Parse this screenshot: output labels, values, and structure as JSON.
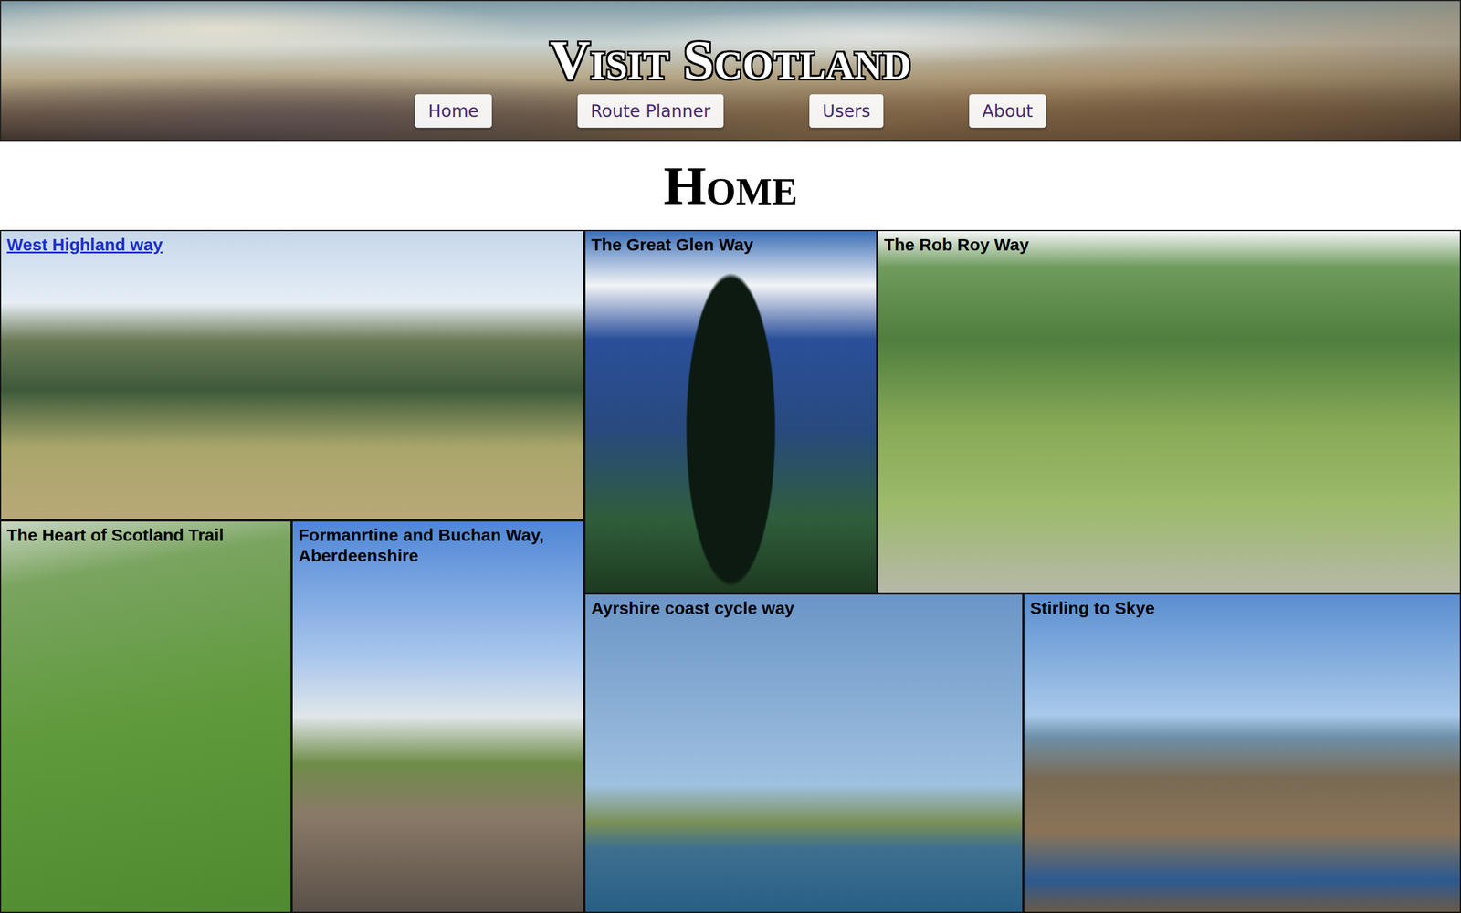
{
  "header": {
    "title": "Visit Scotland"
  },
  "nav": [
    {
      "label": "Home"
    },
    {
      "label": "Route Planner"
    },
    {
      "label": "Users"
    },
    {
      "label": "About"
    }
  ],
  "page": {
    "heading": "Home"
  },
  "routes": [
    {
      "title": "West Highland way",
      "link": true
    },
    {
      "title": "The Great Glen Way",
      "link": false
    },
    {
      "title": "The Rob Roy Way",
      "link": false
    },
    {
      "title": "The Heart of Scotland Trail",
      "link": false
    },
    {
      "title": "Formanrtine and Buchan Way, Aberdeenshire",
      "link": false
    },
    {
      "title": "Ayrshire coast cycle way",
      "link": false
    },
    {
      "title": "Stirling to Skye",
      "link": false
    }
  ]
}
